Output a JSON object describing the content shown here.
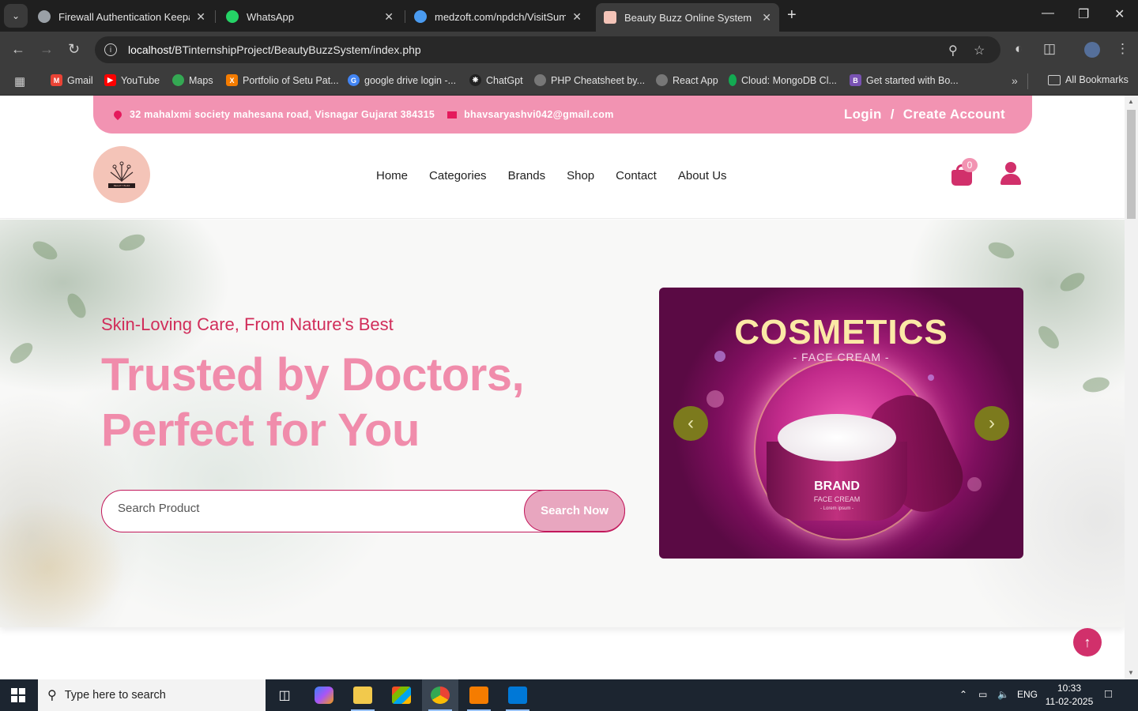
{
  "browser": {
    "tabs": [
      {
        "label": "Firewall Authentication Keepalive",
        "favicon_color": "#9aa0a6",
        "active": false
      },
      {
        "label": "WhatsApp",
        "favicon_color": "#25d366",
        "active": false
      },
      {
        "label": "medzoft.com/npdch/VisitSummary",
        "favicon_color": "#4a9bf0",
        "active": false
      },
      {
        "label": "Beauty Buzz Online System",
        "favicon_color": "#f4c4b8",
        "active": true
      }
    ],
    "url_host": "localhost",
    "url_path": "/BTinternshipProject/BeautyBuzzSystem/index.php",
    "bookmarks": [
      {
        "label": "Gmail",
        "color": "#ea4335"
      },
      {
        "label": "YouTube",
        "color": "#ff0000"
      },
      {
        "label": "Maps",
        "color": "#34a853"
      },
      {
        "label": "Portfolio of Setu Pat...",
        "color": "#f57c00"
      },
      {
        "label": "google drive login -...",
        "color": "#4285f4"
      },
      {
        "label": "ChatGpt",
        "color": "#222222"
      },
      {
        "label": "PHP Cheatsheet by...",
        "color": "#777777"
      },
      {
        "label": "React App",
        "color": "#777777"
      },
      {
        "label": "Cloud: MongoDB Cl...",
        "color": "#13aa52"
      },
      {
        "label": "Get started with Bo...",
        "color": "#7952b3"
      }
    ],
    "all_bookmarks": "All Bookmarks"
  },
  "topbar": {
    "address": "32 mahalxmi society mahesana road, Visnagar Gujarat 384315",
    "email": "bhavsaryashvi042@gmail.com",
    "login": "Login",
    "separator": "/",
    "create_account": "Create Account"
  },
  "nav": {
    "logo_text": "BEAUTY BUZZ",
    "links": [
      "Home",
      "Categories",
      "Brands",
      "Shop",
      "Contact",
      "About Us"
    ],
    "cart_count": "0"
  },
  "hero": {
    "subtitle": "Skin-Loving Care, From Nature's Best",
    "headline_line1": "Trusted by Doctors,",
    "headline_line2": "Perfect for You",
    "search_placeholder": "Search Product",
    "search_button": "Search Now"
  },
  "carousel": {
    "title": "COSMETICS",
    "subtitle": "- FACE CREAM -",
    "brand": "BRAND",
    "product": "FACE CREAM",
    "lorem": "- Lorem ipsum -"
  },
  "taskbar": {
    "search_placeholder": "Type here to search",
    "language": "ENG",
    "time": "10:33",
    "date": "11-02-2025"
  }
}
